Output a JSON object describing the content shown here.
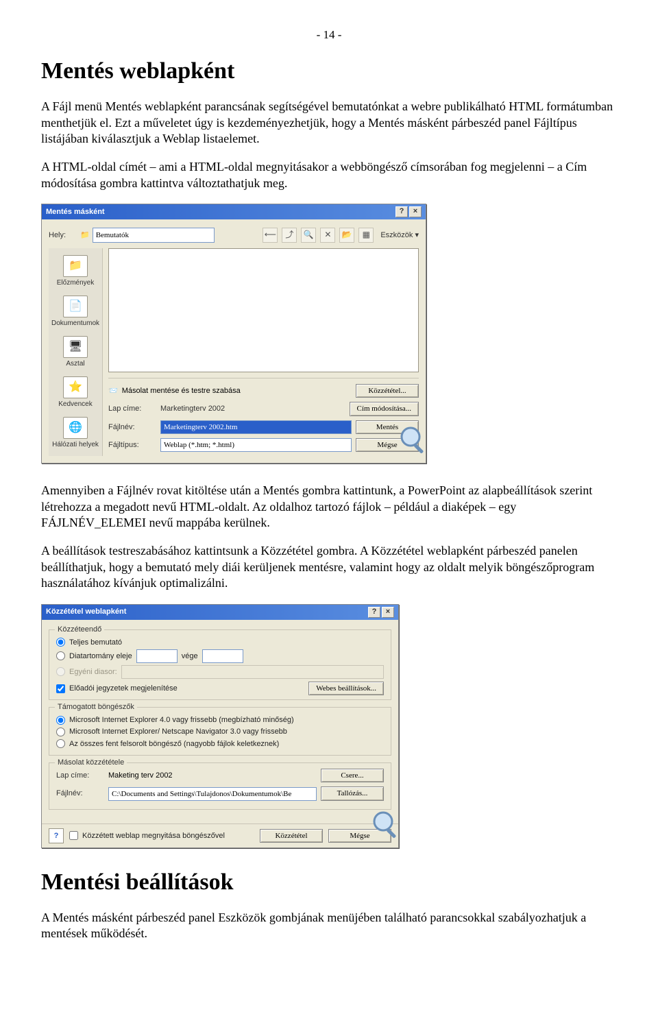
{
  "page_number": "- 14 -",
  "h1_a": "Mentés weblapként",
  "para1": "A Fájl menü Mentés weblapként parancsának segítségével bemutatónkat a webre publikálható HTML formátumban menthetjük el. Ezt a műveletet úgy is kezdeményezhetjük, hogy a Mentés másként párbeszéd panel Fájltípus listájában kiválasztjuk a Weblap listaelemet.",
  "para2": "A HTML-oldal címét – ami a HTML-oldal megnyitásakor a webböngésző címsorában fog megjelenni – a Cím módosítása gombra kattintva változtathatjuk meg.",
  "para3": "Amennyiben a Fájlnév rovat kitöltése után a Mentés gombra kattintunk, a PowerPoint az alapbeállítások szerint létrehozza a megadott nevű HTML-oldalt. Az oldalhoz tartozó fájlok – például a diaképek – egy FÁJLNÉV_ELEMEI nevű mappába kerülnek.",
  "para4": "A beállítások testreszabásához kattintsunk a Közzététel gombra. A Közzététel weblapként párbeszéd panelen beállíthatjuk, hogy a bemutató mely diái kerüljenek mentésre, valamint hogy az oldalt melyik böngészőprogram használatához kívánjuk optimalizálni.",
  "h1_b": "Mentési beállítások",
  "para5": "A Mentés másként párbeszéd panel Eszközök gombjának menüjében található parancsokkal szabályozhatjuk a mentések működését.",
  "saveas": {
    "title": "Mentés másként",
    "lbl_location": "Hely:",
    "location_value": "Bemutatók",
    "tools_label": "Eszközök",
    "sidebar": [
      {
        "icon": "📁",
        "label": "Előzmények"
      },
      {
        "icon": "📄",
        "label": "Dokumentumok"
      },
      {
        "icon": "🖥",
        "label": "Asztal"
      },
      {
        "icon": "⭐",
        "label": "Kedvencek"
      },
      {
        "icon": "🌐",
        "label": "Hálózati helyek"
      }
    ],
    "save_customize_text": "Másolat mentése és testre szabása",
    "publish_btn": "Közzététel...",
    "lbl_page_title": "Lap címe:",
    "page_title_value": "Marketingterv 2002",
    "change_title_btn": "Cím módosítása...",
    "lbl_filename": "Fájlnév:",
    "filename_value": "Marketingterv 2002.htm",
    "save_btn": "Mentés",
    "lbl_filetype": "Fájltípus:",
    "filetype_value": "Weblap (*.htm; *.html)",
    "cancel_btn": "Mégse"
  },
  "publish": {
    "title": "Közzététel weblapként",
    "group_what": "Közzéteendő",
    "opt_full": "Teljes bemutató",
    "opt_range_start": "Diatartomány eleje",
    "opt_range_end": "vége",
    "opt_custom": "Egyéni diasor:",
    "chk_notes": "Előadói jegyzetek megjelenítése",
    "btn_websettings": "Webes beállítások...",
    "group_browsers": "Támogatott böngészők",
    "opt_ie4": "Microsoft Internet Explorer 4.0 vagy frissebb (megbízható minőség)",
    "opt_ns3": "Microsoft Internet Explorer/ Netscape Navigator 3.0 vagy frissebb",
    "opt_all": "Az összes fent felsorolt böngésző (nagyobb fájlok keletkeznek)",
    "group_copy": "Másolat közzététele",
    "lbl_page_title": "Lap címe:",
    "page_title_value": "Maketing terv 2002",
    "btn_change": "Csere...",
    "lbl_filename": "Fájlnév:",
    "filename_value": "C:\\Documents and Settings\\Tulajdonos\\Dokumentumok\\Be",
    "btn_browse": "Tallózás...",
    "chk_open": "Közzétett weblap megnyitása böngészővel",
    "btn_publish": "Közzététel",
    "btn_cancel": "Mégse"
  }
}
